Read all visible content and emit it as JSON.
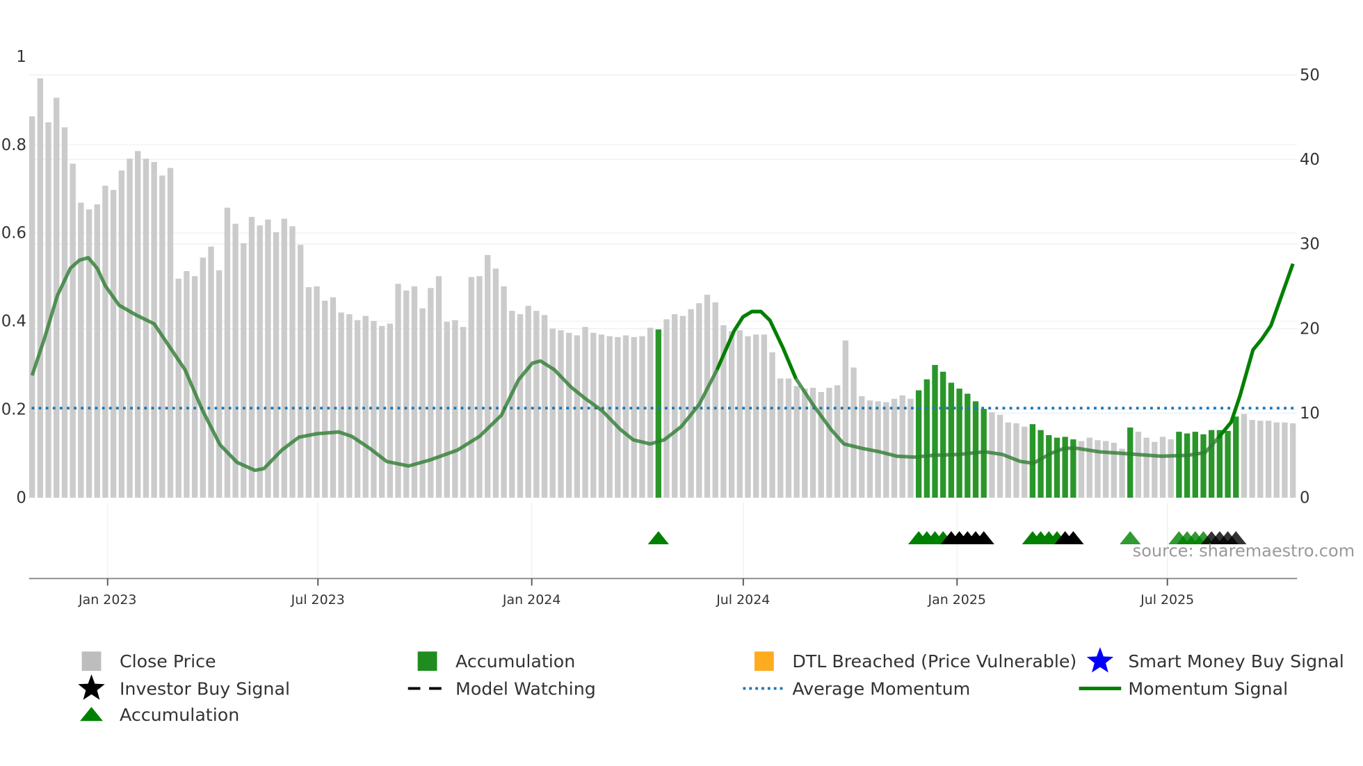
{
  "chart_data": {
    "type": "bar",
    "title": "",
    "start_week": "2022-10-28",
    "frequency": "weekly",
    "left_axis": {
      "ticks": [
        "0",
        "0.2",
        "0.4",
        "0.6",
        "0.8",
        "1"
      ],
      "tick_values": [
        0,
        0.2,
        0.4,
        0.6,
        0.8,
        1
      ],
      "ylim": [
        0,
        1
      ]
    },
    "right_axis": {
      "ticks": [
        "0",
        "10",
        "20",
        "30",
        "40",
        "50"
      ],
      "tick_values": [
        0,
        10,
        20,
        30,
        40,
        50
      ],
      "ylim": [
        0,
        50
      ]
    },
    "x_ticks": [
      {
        "label": "Jan 2023",
        "date": "2023-01-01"
      },
      {
        "label": "Jul 2023",
        "date": "2023-07-01"
      },
      {
        "label": "Jan 2024",
        "date": "2024-01-01"
      },
      {
        "label": "Jul 2024",
        "date": "2024-07-01"
      },
      {
        "label": "Jan 2025",
        "date": "2025-01-01"
      },
      {
        "label": "Jul 2025",
        "date": "2025-07-01"
      }
    ],
    "close_price": [
      45.1,
      49.6,
      44.4,
      47.3,
      43.8,
      39.5,
      34.9,
      34.1,
      34.7,
      36.9,
      36.4,
      38.7,
      40.1,
      41.0,
      40.1,
      39.7,
      38.1,
      39.0,
      25.9,
      26.8,
      26.2,
      28.4,
      29.7,
      26.9,
      34.3,
      32.4,
      30.1,
      33.2,
      32.2,
      32.9,
      31.4,
      33.0,
      32.1,
      29.9,
      24.9,
      25.0,
      23.3,
      23.7,
      21.9,
      21.7,
      21.0,
      21.5,
      20.9,
      20.3,
      20.6,
      25.3,
      24.5,
      25.0,
      22.4,
      24.8,
      26.2,
      20.8,
      21.0,
      20.2,
      26.1,
      26.2,
      28.7,
      27.1,
      25.0,
      22.1,
      21.7,
      22.7,
      22.1,
      21.6,
      20.0,
      19.8,
      19.5,
      19.2,
      20.2,
      19.5,
      19.3,
      19.1,
      19.0,
      19.2,
      19.0,
      19.1,
      20.1,
      19.9,
      21.1,
      21.7,
      21.5,
      22.3,
      23.0,
      24.0,
      23.1,
      20.4,
      19.7,
      19.8,
      19.1,
      19.3,
      19.3,
      17.2,
      14.1,
      14.1,
      13.2,
      12.9,
      13.0,
      12.5,
      13.0,
      13.3,
      18.6,
      15.4,
      12.0,
      11.5,
      11.4,
      11.3,
      11.7,
      12.1,
      11.7,
      12.7,
      14.0,
      15.7,
      14.9,
      13.6,
      12.9,
      12.3,
      11.4,
      10.5,
      10.1,
      9.8,
      8.9,
      8.8,
      8.4,
      8.7,
      8.0,
      7.4,
      7.1,
      7.2,
      6.9,
      6.7,
      7.1,
      6.8,
      6.7,
      6.5,
      5.8,
      8.3,
      7.8,
      7.1,
      6.6,
      7.2,
      6.9,
      7.8,
      7.6,
      7.8,
      7.5,
      8.0,
      8.0,
      7.9,
      9.6,
      9.9,
      9.2,
      9.1,
      9.1,
      8.9,
      8.9,
      8.8
    ],
    "accumulation_weeks": [
      [
        78,
        78
      ],
      [
        110,
        118
      ],
      [
        124,
        129
      ],
      [
        136,
        136
      ],
      [
        142,
        149
      ]
    ],
    "momentum_signal": [
      [
        1,
        0.277
      ],
      [
        2.5,
        0.36
      ],
      [
        4.1,
        0.458
      ],
      [
        5.7,
        0.52
      ],
      [
        6.8,
        0.538
      ],
      [
        7.9,
        0.544
      ],
      [
        9,
        0.52
      ],
      [
        10,
        0.48
      ],
      [
        11.7,
        0.436
      ],
      [
        13.8,
        0.414
      ],
      [
        16,
        0.394
      ],
      [
        17.6,
        0.35
      ],
      [
        19.8,
        0.29
      ],
      [
        21.9,
        0.2
      ],
      [
        24.1,
        0.12
      ],
      [
        26.2,
        0.08
      ],
      [
        28.4,
        0.062
      ],
      [
        29.5,
        0.066
      ],
      [
        31.7,
        0.108
      ],
      [
        33.8,
        0.137
      ],
      [
        36,
        0.145
      ],
      [
        38.7,
        0.149
      ],
      [
        40.3,
        0.139
      ],
      [
        42.5,
        0.112
      ],
      [
        44.6,
        0.082
      ],
      [
        47.3,
        0.072
      ],
      [
        50,
        0.086
      ],
      [
        53.3,
        0.108
      ],
      [
        56,
        0.139
      ],
      [
        58.7,
        0.187
      ],
      [
        60.8,
        0.267
      ],
      [
        62.5,
        0.305
      ],
      [
        63.5,
        0.31
      ],
      [
        65.2,
        0.29
      ],
      [
        67.3,
        0.25
      ],
      [
        69,
        0.225
      ],
      [
        71.1,
        0.197
      ],
      [
        73.3,
        0.155
      ],
      [
        74.9,
        0.131
      ],
      [
        77,
        0.122
      ],
      [
        78.7,
        0.131
      ],
      [
        80.8,
        0.161
      ],
      [
        83,
        0.211
      ],
      [
        85.2,
        0.29
      ],
      [
        87.3,
        0.378
      ],
      [
        88.4,
        0.41
      ],
      [
        89.5,
        0.422
      ],
      [
        90.6,
        0.422
      ],
      [
        91.7,
        0.402
      ],
      [
        93.3,
        0.34
      ],
      [
        94.9,
        0.27
      ],
      [
        97,
        0.211
      ],
      [
        99.2,
        0.155
      ],
      [
        100.8,
        0.122
      ],
      [
        103,
        0.112
      ],
      [
        105.2,
        0.104
      ],
      [
        107.3,
        0.094
      ],
      [
        109.5,
        0.092
      ],
      [
        111.7,
        0.096
      ],
      [
        114.9,
        0.098
      ],
      [
        118.1,
        0.104
      ],
      [
        120.3,
        0.098
      ],
      [
        122.5,
        0.082
      ],
      [
        124.1,
        0.078
      ],
      [
        126.2,
        0.1
      ],
      [
        127.9,
        0.112
      ],
      [
        129.5,
        0.112
      ],
      [
        132.2,
        0.104
      ],
      [
        135.4,
        0.1
      ],
      [
        139.8,
        0.094
      ],
      [
        143,
        0.096
      ],
      [
        145.2,
        0.102
      ],
      [
        146.8,
        0.135
      ],
      [
        148.4,
        0.171
      ],
      [
        149.5,
        0.231
      ],
      [
        151.1,
        0.335
      ],
      [
        152.2,
        0.36
      ],
      [
        153.3,
        0.39
      ],
      [
        156,
        0.53
      ]
    ],
    "momentum_active_weeks": [
      [
        86,
        95
      ],
      [
        147,
        156
      ]
    ],
    "average_momentum": 0.203,
    "accumulation_triangles": [
      78,
      110,
      111,
      112,
      113,
      124,
      125,
      126,
      127,
      136,
      142,
      143,
      144,
      145
    ],
    "investor_triangles": [
      114,
      115,
      116,
      117,
      118,
      128,
      129,
      146,
      147,
      148,
      149
    ],
    "faded_triangle_weeks": [
      136,
      142,
      143,
      144,
      145,
      146,
      147,
      148,
      149
    ],
    "source": "source: sharemaestro.com",
    "legend": [
      {
        "label": "Close Price",
        "icon": "gray-square",
        "color": "#bdbdbd"
      },
      {
        "label": "Accumulation",
        "icon": "green-square",
        "color": "#1e8c1e"
      },
      {
        "label": "DTL Breached (Price Vulnerable)",
        "icon": "orange-square",
        "color": "#ffab1f"
      },
      {
        "label": "Smart Money Buy Signal",
        "icon": "blue-star",
        "color": "#0000ff"
      },
      {
        "label": "Investor Buy Signal",
        "icon": "black-star",
        "color": "#000000"
      },
      {
        "label": "Model Watching",
        "icon": "black-dashed-line",
        "color": "#000000"
      },
      {
        "label": "Average Momentum",
        "icon": "blue-dotted-line",
        "color": "#1f77b4"
      },
      {
        "label": "Momentum Signal",
        "icon": "green-line",
        "color": "#008000"
      },
      {
        "label": "Accumulation",
        "icon": "green-triangle",
        "color": "#008000"
      }
    ]
  }
}
